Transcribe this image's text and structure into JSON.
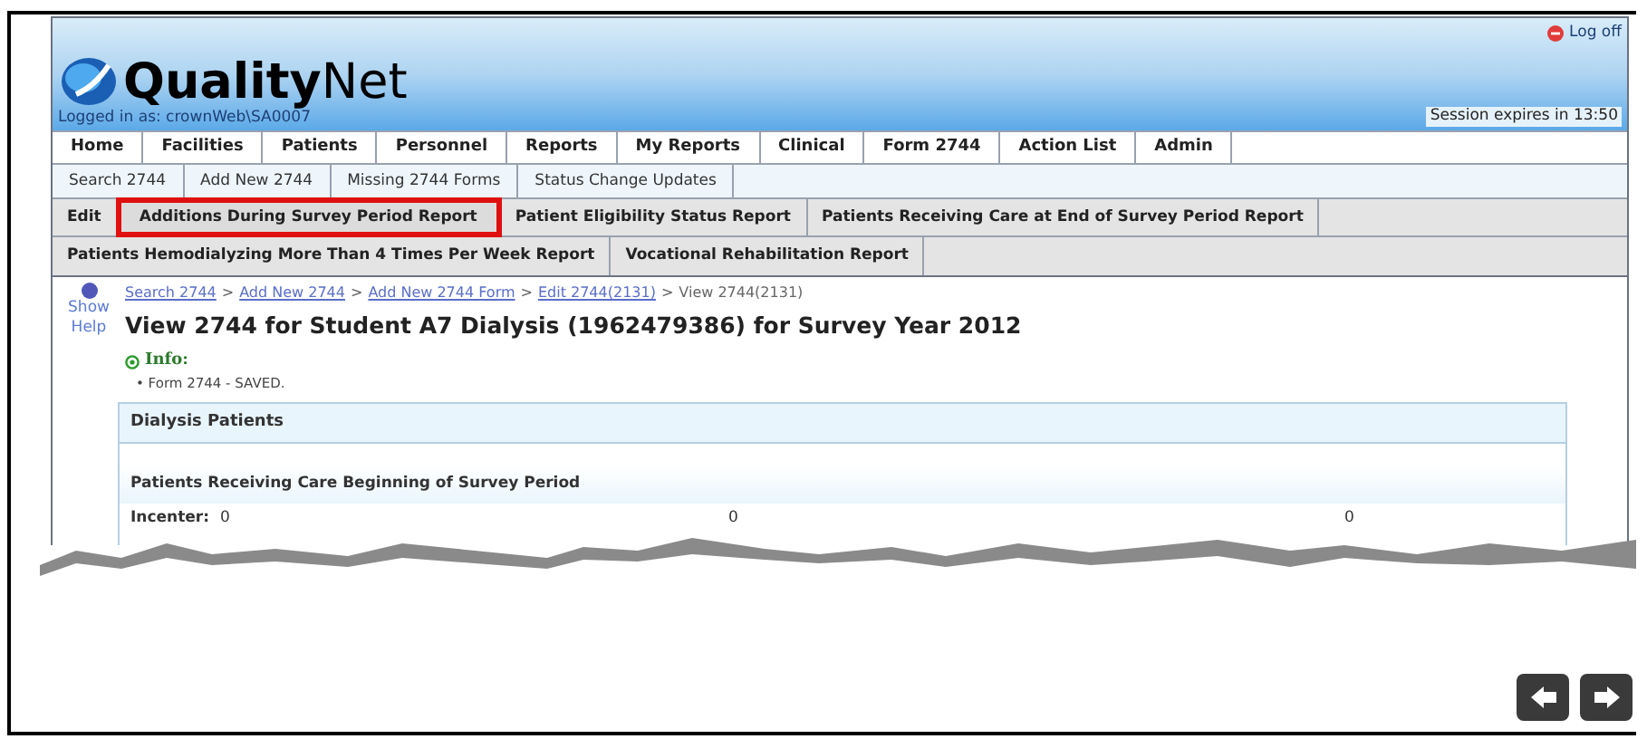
{
  "header": {
    "logo": "QualityNet",
    "logged_in": "Logged in as: crownWeb\\SA0007",
    "log_off": "Log off",
    "session": "Session expires in 13:50"
  },
  "main_nav": [
    {
      "label": "Home"
    },
    {
      "label": "Facilities"
    },
    {
      "label": "Patients"
    },
    {
      "label": "Personnel"
    },
    {
      "label": "Reports"
    },
    {
      "label": "My Reports"
    },
    {
      "label": "Clinical"
    },
    {
      "label": "Form 2744"
    },
    {
      "label": "Action List"
    },
    {
      "label": "Admin"
    }
  ],
  "sub_nav": [
    {
      "label": "Search 2744"
    },
    {
      "label": "Add New 2744"
    },
    {
      "label": "Missing 2744 Forms"
    },
    {
      "label": "Status Change Updates"
    }
  ],
  "report_tabs": [
    [
      {
        "label": "Edit",
        "highlighted": false
      },
      {
        "label": "Additions During Survey Period Report",
        "highlighted": true
      },
      {
        "label": "Patient Eligibility Status Report",
        "highlighted": false
      },
      {
        "label": "Patients Receiving Care at End of Survey Period Report",
        "highlighted": false
      }
    ],
    [
      {
        "label": "Patients Hemodialyzing More Than 4 Times Per Week Report",
        "highlighted": false
      },
      {
        "label": "Vocational Rehabilitation Report",
        "highlighted": false
      }
    ]
  ],
  "help": "Show Help",
  "breadcrumb": [
    {
      "label": "Search 2744",
      "link": true
    },
    {
      "label": ">"
    },
    {
      "label": "Add New 2744",
      "link": true
    },
    {
      "label": ">"
    },
    {
      "label": "Add New 2744 Form",
      "link": true
    },
    {
      "label": ">"
    },
    {
      "label": "Edit 2744(2131)",
      "link": true
    },
    {
      "label": ">"
    },
    {
      "label": "View 2744(2131)",
      "link": false
    }
  ],
  "title": "View 2744 for Student A7 Dialysis (1962479386) for Survey Year 2012",
  "info": {
    "heading": "Info:",
    "message": "• Form 2744 - SAVED."
  },
  "panel": {
    "title": "Dialysis Patients",
    "section": "Patients Receiving Care Beginning of Survey Period",
    "fields": [
      {
        "label": "Incenter:",
        "value": "0"
      },
      {
        "value": "0"
      },
      {
        "value": "0"
      }
    ]
  }
}
